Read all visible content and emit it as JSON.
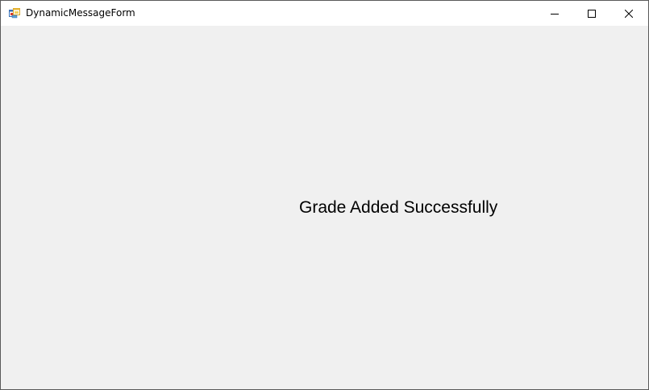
{
  "window": {
    "title": "DynamicMessageForm",
    "icon": "form-app-icon",
    "controls": {
      "minimize_icon": "minimize-icon",
      "maximize_icon": "maximize-icon",
      "close_icon": "close-icon"
    }
  },
  "client": {
    "message": "Grade Added Successfully"
  },
  "colors": {
    "titlebar": "#ffffff",
    "client_background": "#f0f0f0",
    "border": "#5a5a5a",
    "text": "#000000"
  }
}
